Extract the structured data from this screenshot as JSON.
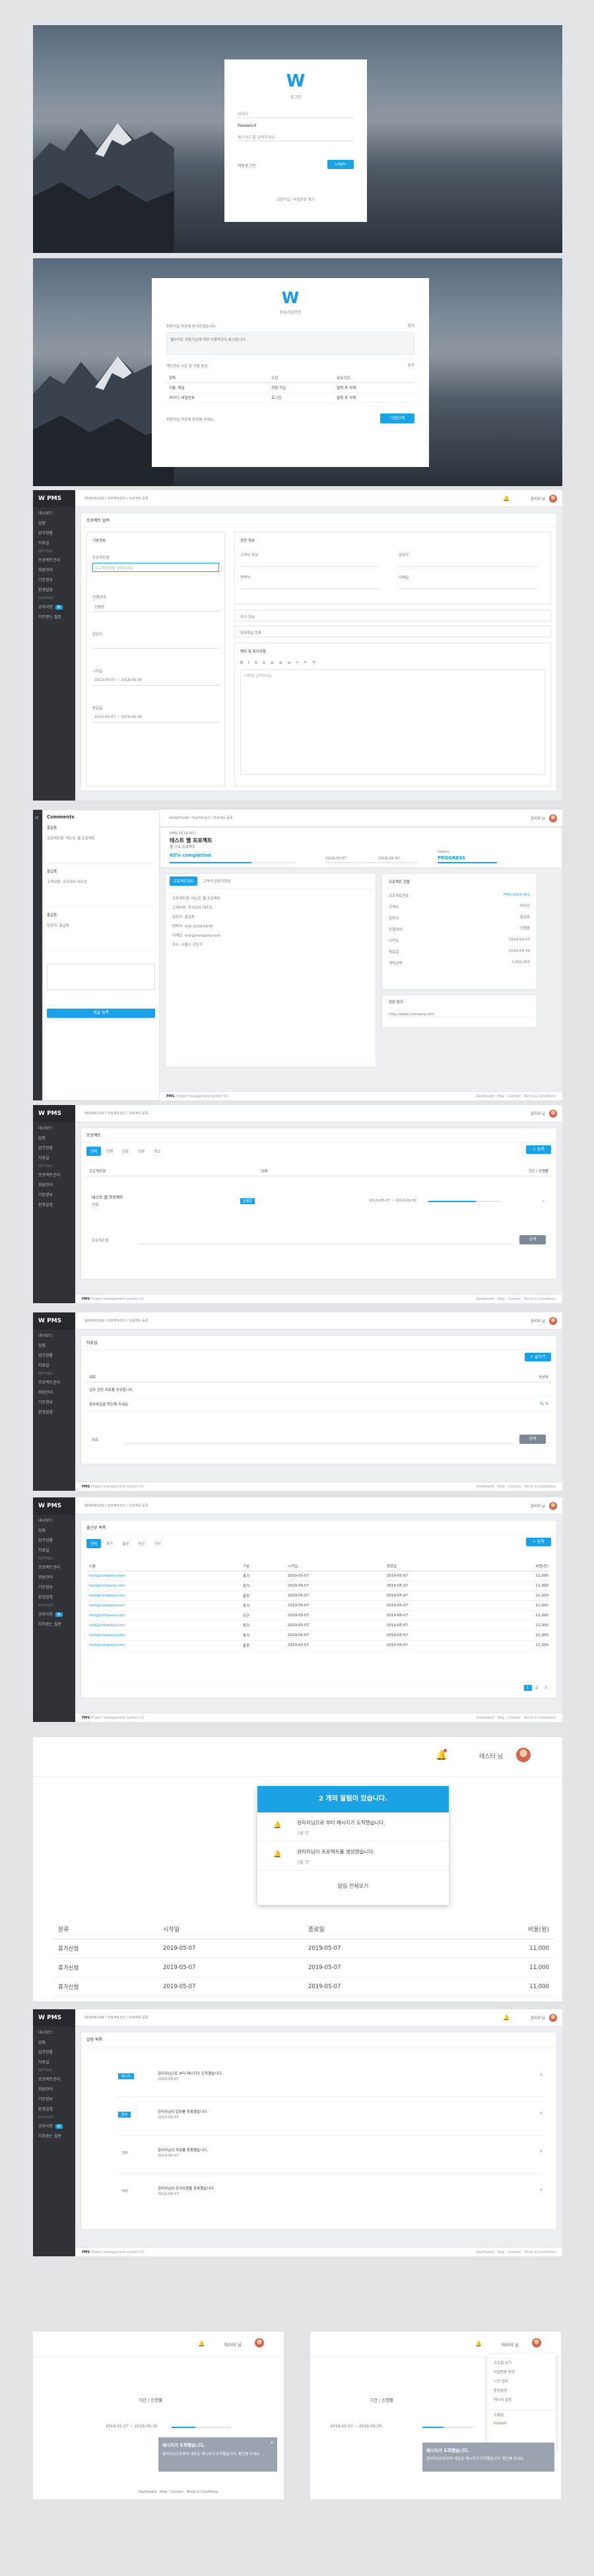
{
  "login": {
    "title": "로그인",
    "user_placeholder": "아이디",
    "password_label": "Password",
    "password_hint": "패스워드를 입력하세요",
    "remember": "자동로그인",
    "login_button": "Login",
    "signup_text": "회원가입 | 비밀번호 찾기"
  },
  "signup": {
    "title": "회원가입약관",
    "agree_title": "회원가입 약관에 동의하겠습니다.",
    "agree_note": "웹사이트 회원가입에 대한 이용약관이 표시됩니다.",
    "privacy_title": "개인정보 수집 및 이용 동의",
    "agree_label": "동의",
    "table_headers": [
      "항목",
      "수집",
      "보유기간"
    ],
    "table_rows": [
      [
        "이름, 메일",
        "회원 가입",
        "탈퇴 후 삭제"
      ],
      [
        "아이디, 비밀번호",
        "로그인",
        "탈퇴 후 삭제"
      ]
    ],
    "footer_note": "회원가입 약관에 동의해 주세요.",
    "next_button": "다음단계"
  },
  "nav": {
    "brand": "PMS",
    "items": [
      "대시보드",
      "알림",
      "업무현황",
      "자료실",
      "프로젝트",
      "회의록",
      "나의업무",
      "게시판"
    ],
    "headers": [
      "SETTING",
      "SUPPORT"
    ],
    "setting_items": [
      "프로젝트관리",
      "회원관리",
      "기본정보",
      "환경설정"
    ],
    "support_items": [
      "공지사항",
      "자주묻는 질문"
    ],
    "badge": "N"
  },
  "top": {
    "crumb": "WORKFLOW / 프로젝트관리 / 프로젝트 등록",
    "user": "관리자 님"
  },
  "form": {
    "title": "프로젝트 입력",
    "basic_title": "기본정보",
    "name_label": "프로젝트명",
    "name_placeholder": "프로젝트명을 입력하세요",
    "client_label": "고객사",
    "status_label": "진행상태",
    "status_value": "진행중",
    "manager_label": "담당자",
    "start_label": "시작일",
    "end_label": "종료일",
    "date_value": "2019-05-07 ~ 2019-09-30",
    "extra_title": "관련 정보",
    "client_info": "고객사 정보",
    "contact": "담당자",
    "phone": "연락처",
    "email": "이메일",
    "note_title": "추가 정보",
    "file_title": "첨부파일 등록",
    "memo_title": "메모 및 특이사항",
    "editor_label": "내용을 입력하세요"
  },
  "detail": {
    "comments": "Comments",
    "proj_code": "PMS-2019-001",
    "proj_name": "테스트 웹 프로젝트",
    "proj_sub": "웹 구축 프로젝트",
    "progress_label": "65% completion",
    "progress": 0.65,
    "date_from": "2019-05-07",
    "date_to": "2019-09-30",
    "status_label": "Status",
    "status_value": "PROGRESS",
    "tab1": "프로젝트정보",
    "tab2": "고객사 담당자정보",
    "info_rows": [
      "프로젝트명: 테스트 웹 프로젝트",
      "고객사명: 주식회사 테스트",
      "담당자: 홍길동",
      "연락처: 010-1234-5678",
      "이메일: test@company.com",
      "주소: 서울시 강남구"
    ],
    "side_title": "프로젝트 현황",
    "side_rows": [
      [
        "프로젝트번호",
        "PMS-2019-001"
      ],
      [
        "고객사",
        "테스트"
      ],
      [
        "담당자",
        "홍길동"
      ],
      [
        "진행상태",
        "진행중"
      ],
      [
        "시작일",
        "2019-05-07"
      ],
      [
        "종료일",
        "2019-09-30"
      ],
      [
        "계약금액",
        "3,000,000"
      ]
    ],
    "link_title": "관련 링크",
    "link_value": "http://www.company.com",
    "send": "댓글 등록"
  },
  "list": {
    "title": "프로젝트",
    "tabs": [
      "전체",
      "진행",
      "완료",
      "보류",
      "취소"
    ],
    "add_button": "+ 등록",
    "headers": [
      "프로젝트명",
      "상태",
      "기간 / 진행률"
    ],
    "row_name": "테스트 웹 프로젝트",
    "row_sub": "진행",
    "row_badge": "진행중",
    "row_date": "2019-05-07 ~ 2019-09-30",
    "search_label": "프로젝트명",
    "search_button": "검색"
  },
  "board": {
    "title": "자료실",
    "write_button": "+ 글쓰기",
    "headers": [
      "제목",
      "작성자"
    ],
    "row": "업무 관련 자료를 공유합니다.",
    "row2": "첨부파일을 확인해 주세요.",
    "search_label": "제목",
    "search_button": "검색"
  },
  "table": {
    "title": "출근부 목록",
    "tabs": [
      "전체",
      "휴가",
      "출장",
      "외근",
      "기타"
    ],
    "add_button": "+ 등록",
    "headers": [
      "이름",
      "구분",
      "시작일",
      "종료일",
      "비용(원)"
    ],
    "rows": [
      [
        "test@company.com",
        "휴가",
        "2019-05-07",
        "2019-05-07",
        "11,000"
      ],
      [
        "test@company.com",
        "휴가",
        "2019-05-07",
        "2019-05-07",
        "11,000"
      ],
      [
        "test@company.com",
        "출장",
        "2019-05-07",
        "2019-05-07",
        "11,000"
      ],
      [
        "test@company.com",
        "휴가",
        "2019-05-07",
        "2019-05-07",
        "11,000"
      ],
      [
        "test@company.com",
        "외근",
        "2019-05-07",
        "2019-05-07",
        "11,000"
      ],
      [
        "test@company.com",
        "휴가",
        "2019-05-07",
        "2019-05-07",
        "11,000"
      ],
      [
        "test@company.com",
        "휴가",
        "2019-05-07",
        "2019-05-07",
        "11,000"
      ],
      [
        "test@company.com",
        "출장",
        "2019-05-07",
        "2019-05-07",
        "11,000"
      ]
    ],
    "pages": [
      "1",
      "2",
      "3"
    ]
  },
  "notif": {
    "header": "2 개의 알림이 있습니다.",
    "items": [
      {
        "text": "관리자님으로 부터 메시지가 도착했습니다.",
        "time": "1분 전"
      },
      {
        "text": "관리자님이 프로젝트를 생성했습니다.",
        "time": "3분 전"
      }
    ],
    "view_all": "알림 전체보기",
    "user": "테스터 님",
    "table_headers": [
      "분류",
      "시작일",
      "종료일",
      "비용(원)"
    ],
    "rows": [
      [
        "휴가신청",
        "2019-05-07",
        "2019-05-07",
        "11,000"
      ],
      [
        "휴가신청",
        "2019-05-07",
        "2019-05-07",
        "11,000"
      ],
      [
        "휴가신청",
        "2019-05-07",
        "2019-05-07",
        "11,000"
      ]
    ],
    "cat_col": "분류"
  },
  "alarm": {
    "title": "알림 목록",
    "rows": [
      {
        "tag": "메시지",
        "text": "관리자님으로 부터 메시지가 도착했습니다.",
        "date": "2019-05-07"
      },
      {
        "tag": "업무",
        "text": "관리자님이 업무를 등록했습니다.",
        "date": "2019-05-07"
      },
      {
        "tag": "기타",
        "text": "관리자님이 자료를 등록했습니다.",
        "date": "2019-05-07"
      },
      {
        "tag": "기타",
        "text": "관리자님이 공지사항을 등록했습니다.",
        "date": "2019-05-07"
      }
    ]
  },
  "mini": {
    "user": "테스터 님",
    "col": "기간 / 진행률",
    "date": "2019-05-07 ~ 2019-09-30",
    "toast": "메시지가 도착했습니다.",
    "toast_body": "관리자님으로부터 새로운 메시지가 도착했습니다. 확인해 주세요.",
    "menu": [
      "프로필 보기",
      "비밀번호 변경",
      "나의 업무",
      "환경설정",
      "메시지 설정",
      "도움말",
      "Logout"
    ]
  },
  "footer": {
    "brand": "PMS",
    "text": "Project management system V1",
    "links": [
      "Dashboard",
      "Help",
      "Contact",
      "Terms & Conditions"
    ]
  }
}
